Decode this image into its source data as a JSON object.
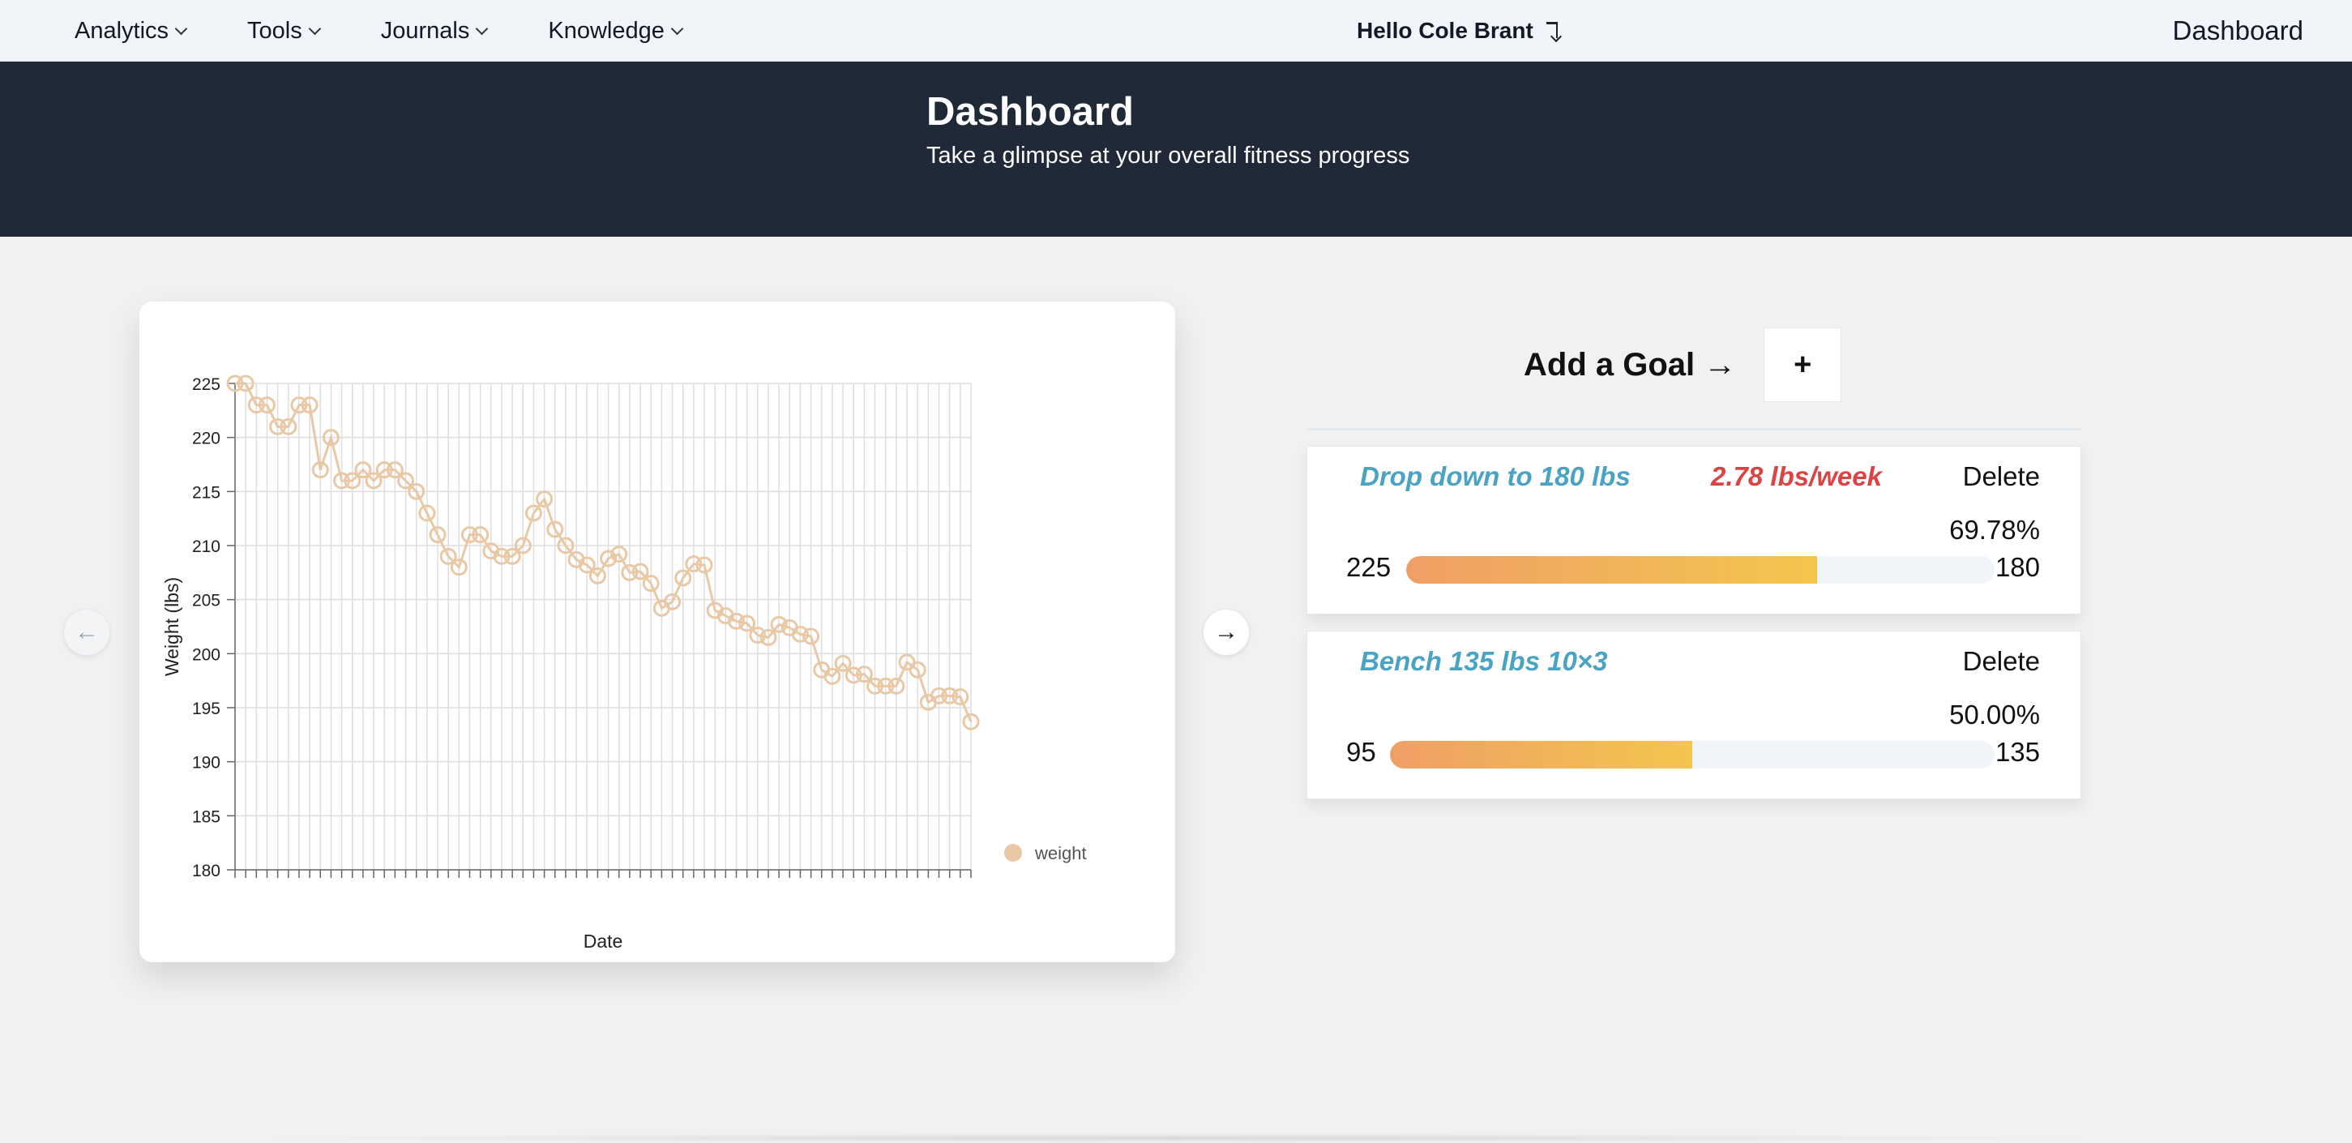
{
  "nav": {
    "menus": [
      {
        "label": "Analytics"
      },
      {
        "label": "Tools"
      },
      {
        "label": "Journals"
      },
      {
        "label": "Knowledge"
      }
    ],
    "greeting": "Hello Cole Brant",
    "right_link": "Dashboard"
  },
  "hero": {
    "title": "Dashboard",
    "subtitle": "Take a glimpse at your overall fitness progress"
  },
  "carousel": {
    "prev_icon": "arrow-left-icon",
    "next_icon": "arrow-right-icon",
    "prev_symbol": "←",
    "next_symbol": "→"
  },
  "goals": {
    "header": "Add a Goal →",
    "add_label": "+",
    "items": [
      {
        "name": "Drop down to 180 lbs",
        "rate": "2.78 lbs/week",
        "delete_label": "Delete",
        "percent_label": "69.78%",
        "progress": 0.6978,
        "start": "225",
        "end": "180"
      },
      {
        "name": "Bench 135 lbs 10×3",
        "rate": "",
        "delete_label": "Delete",
        "percent_label": "50.00%",
        "progress": 0.5,
        "start": "95",
        "end": "135"
      }
    ]
  },
  "colors": {
    "series": "#e9c8a6",
    "accent_blue": "#4aa3c2",
    "accent_red": "#dc4444",
    "hero_bg": "#1f2937"
  },
  "chart_data": {
    "type": "line",
    "xlabel": "Date",
    "ylabel": "Weight (lbs)",
    "ylim": [
      180,
      225
    ],
    "yticks": [
      180,
      185,
      190,
      195,
      200,
      205,
      210,
      215,
      220,
      225
    ],
    "grid": true,
    "legend_position": "right",
    "series": [
      {
        "name": "weight",
        "values": [
          225,
          225,
          223,
          223,
          221,
          221,
          223,
          223,
          217,
          220,
          216,
          216,
          217,
          216,
          217,
          217,
          216,
          215,
          213,
          211,
          209,
          208,
          211,
          211,
          209.5,
          209,
          209,
          210,
          213,
          214.3,
          211.5,
          210,
          208.7,
          208.2,
          207.2,
          208.8,
          209.2,
          207.5,
          207.6,
          206.5,
          204.2,
          204.8,
          207,
          208.3,
          208.2,
          204,
          203.5,
          203,
          202.8,
          201.7,
          201.5,
          202.7,
          202.4,
          201.8,
          201.6,
          198.5,
          197.9,
          199.1,
          198,
          198.1,
          197,
          197,
          197,
          199.2,
          198.5,
          195.5,
          196.1,
          196.1,
          196,
          193.7
        ]
      }
    ]
  }
}
